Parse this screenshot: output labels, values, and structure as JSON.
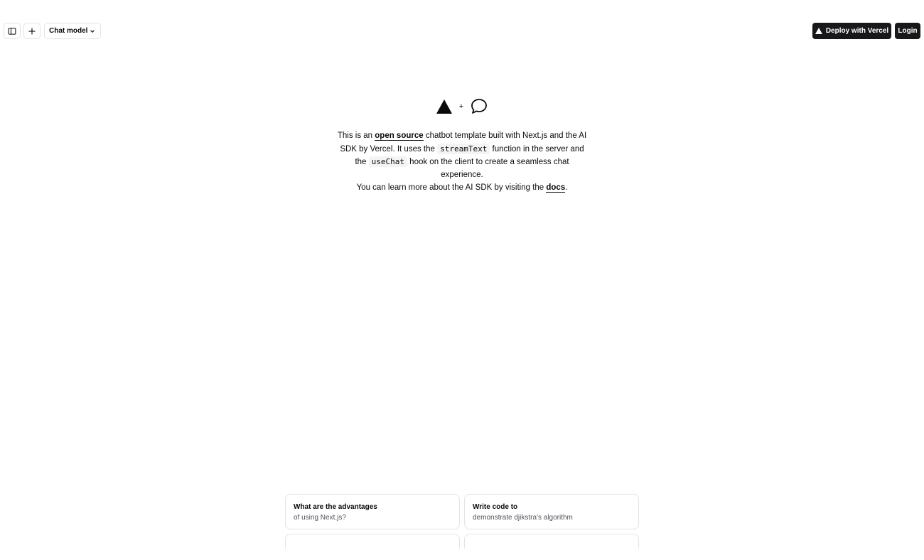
{
  "header": {
    "model_selector_label": "Chat model",
    "deploy_label": "Deploy with Vercel",
    "login_label": "Login"
  },
  "overview": {
    "intro_part1": "This is an ",
    "open_source_link": "open source",
    "intro_part2": " chatbot template built with Next.js and the AI SDK by Vercel. It uses the ",
    "stream_text_code": "streamText",
    "intro_part3": " function in the server and the ",
    "use_chat_code": "useChat",
    "intro_part4": " hook on the client to create a seamless chat experience.",
    "learn_part1": "You can learn more about the AI SDK by visiting the ",
    "docs_link": "docs",
    "learn_part2": "."
  },
  "suggestions": [
    {
      "title": "What are the advantages",
      "subtitle": "of using Next.js?"
    },
    {
      "title": "Write code to",
      "subtitle": "demonstrate djikstra's algorithm"
    }
  ],
  "icons": [
    "sidebar-toggle-icon",
    "plus-icon",
    "chevron-down-icon",
    "vercel-triangle-icon",
    "message-bubble-icon"
  ]
}
